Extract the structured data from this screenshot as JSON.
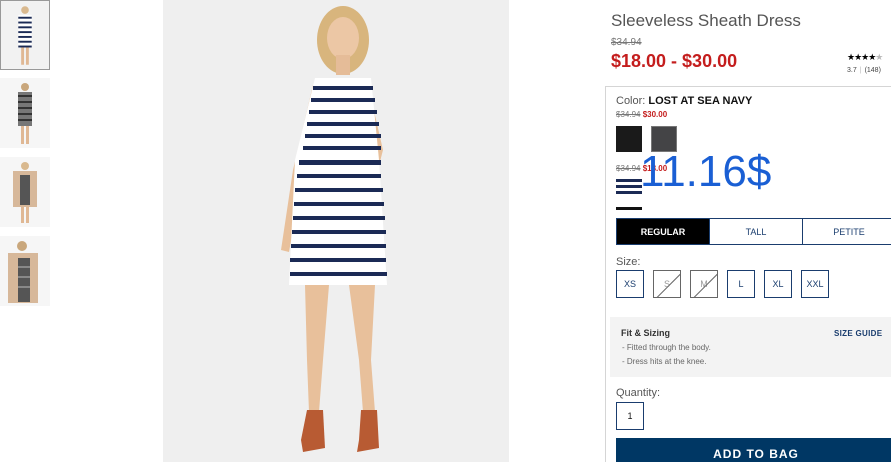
{
  "product": {
    "title": "Sleeveless Sheath Dress",
    "original_price": "$34.94",
    "sale_range": "$18.00 - $30.00",
    "rating_stars": "★★★★",
    "rating_stars_empty": "★",
    "rating_value": "3.7",
    "rating_sep": "|",
    "review_count": "(148)"
  },
  "color": {
    "label": "Color:",
    "selected_name": "LOST AT SEA NAVY",
    "group1_old_price": "$34.94",
    "group1_sale_price": "$30.00",
    "group2_old_price": "$34.94",
    "group2_sale_price": "$18.00",
    "swatches": [
      {
        "name": "black",
        "color": "#1a1a1a"
      },
      {
        "name": "charcoal",
        "color": "#444446"
      },
      {
        "name": "lost-at-sea-navy-stripe",
        "color": "#1b2a55"
      }
    ]
  },
  "overlay_price": "11.16$",
  "fit_tabs": [
    {
      "label": "REGULAR",
      "active": true
    },
    {
      "label": "TALL",
      "active": false
    },
    {
      "label": "PETITE",
      "active": false
    }
  ],
  "size": {
    "label": "Size:",
    "options": [
      {
        "label": "XS",
        "available": true
      },
      {
        "label": "S",
        "available": false
      },
      {
        "label": "M",
        "available": false
      },
      {
        "label": "L",
        "available": true
      },
      {
        "label": "XL",
        "available": true
      },
      {
        "label": "XXL",
        "available": true
      }
    ]
  },
  "fit_sizing": {
    "title": "Fit & Sizing",
    "guide_label": "SIZE GUIDE",
    "lines": [
      "- Fitted through the body.",
      "- Dress hits at the knee."
    ]
  },
  "quantity": {
    "label": "Quantity:",
    "value": "1"
  },
  "add_to_bag": "ADD TO BAG",
  "colors": {
    "sale_red": "#c41d1d",
    "navy": "#1a3d6e",
    "button_navy": "#003764",
    "overlay_blue": "#1a5fd4"
  }
}
